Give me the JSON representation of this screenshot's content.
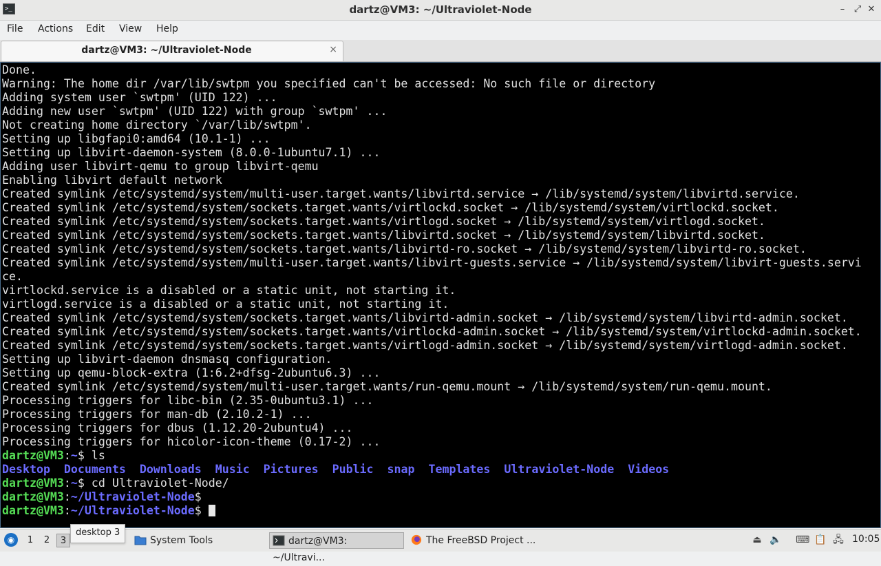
{
  "window": {
    "title": "dartz@VM3: ~/Ultraviolet-Node",
    "controls": [
      "minimize-icon",
      "restore-icon",
      "close-icon"
    ]
  },
  "menu": {
    "items": [
      "File",
      "Actions",
      "Edit",
      "View",
      "Help"
    ]
  },
  "tab": {
    "label": "dartz@VM3: ~/Ultraviolet-Node",
    "close": "×"
  },
  "terminal": {
    "output_lines": [
      "Done.",
      "Warning: The home dir /var/lib/swtpm you specified can't be accessed: No such file or directory",
      "Adding system user `swtpm' (UID 122) ...",
      "Adding new user `swtpm' (UID 122) with group `swtpm' ...",
      "Not creating home directory `/var/lib/swtpm'.",
      "Setting up libgfapi0:amd64 (10.1-1) ...",
      "Setting up libvirt-daemon-system (8.0.0-1ubuntu7.1) ...",
      "Adding user libvirt-qemu to group libvirt-qemu",
      "Enabling libvirt default network",
      "Created symlink /etc/systemd/system/multi-user.target.wants/libvirtd.service → /lib/systemd/system/libvirtd.service.",
      "Created symlink /etc/systemd/system/sockets.target.wants/virtlockd.socket → /lib/systemd/system/virtlockd.socket.",
      "Created symlink /etc/systemd/system/sockets.target.wants/virtlogd.socket → /lib/systemd/system/virtlogd.socket.",
      "Created symlink /etc/systemd/system/sockets.target.wants/libvirtd.socket → /lib/systemd/system/libvirtd.socket.",
      "Created symlink /etc/systemd/system/sockets.target.wants/libvirtd-ro.socket → /lib/systemd/system/libvirtd-ro.socket.",
      "Created symlink /etc/systemd/system/multi-user.target.wants/libvirt-guests.service → /lib/systemd/system/libvirt-guests.servi",
      "ce.",
      "virtlockd.service is a disabled or a static unit, not starting it.",
      "virtlogd.service is a disabled or a static unit, not starting it.",
      "Created symlink /etc/systemd/system/sockets.target.wants/libvirtd-admin.socket → /lib/systemd/system/libvirtd-admin.socket.",
      "Created symlink /etc/systemd/system/sockets.target.wants/virtlockd-admin.socket → /lib/systemd/system/virtlockd-admin.socket.",
      "Created symlink /etc/systemd/system/sockets.target.wants/virtlogd-admin.socket → /lib/systemd/system/virtlogd-admin.socket.",
      "Setting up libvirt-daemon dnsmasq configuration.",
      "Setting up qemu-block-extra (1:6.2+dfsg-2ubuntu6.3) ...",
      "Created symlink /etc/systemd/system/multi-user.target.wants/run-qemu.mount → /lib/systemd/system/run-qemu.mount.",
      "Processing triggers for libc-bin (2.35-0ubuntu3.1) ...",
      "Processing triggers for man-db (2.10.2-1) ...",
      "Processing triggers for dbus (1.12.20-2ubuntu4) ...",
      "Processing triggers for hicolor-icon-theme (0.17-2) ..."
    ],
    "prompt_user": "dartz@VM3",
    "prompts": [
      {
        "path": "~",
        "command": " ls"
      },
      {
        "path": "~",
        "command": " cd Ultraviolet-Node/"
      },
      {
        "path": "~/Ultraviolet-Node",
        "command": ""
      },
      {
        "path": "~/Ultraviolet-Node",
        "command": " "
      }
    ],
    "ls_dirs": [
      "Desktop",
      "Documents",
      "Downloads",
      "Music",
      "Pictures",
      "Public",
      "snap",
      "Templates",
      "Ultraviolet-Node",
      "Videos"
    ]
  },
  "taskbar": {
    "workspaces": [
      "1",
      "2",
      "3"
    ],
    "active_workspace": "3",
    "tooltip": "desktop 3",
    "tasks": [
      {
        "label": "System Tools",
        "icon": "folder-icon"
      },
      {
        "label": "dartz@VM3: ~/Ultravi...",
        "icon": "terminal-icon"
      },
      {
        "label": "The FreeBSD Project ...",
        "icon": "firefox-icon"
      }
    ],
    "tray_icons": [
      "eject-icon",
      "volume-icon",
      "keyboard-icon",
      "clipboard-icon",
      "network-icon"
    ],
    "clock": "10:05"
  },
  "colors": {
    "terminal_bg": "#000000",
    "terminal_fg": "#e0e0e0",
    "prompt_user": "#55dd55",
    "prompt_path": "#6b6bff",
    "directory": "#6b6bff"
  }
}
